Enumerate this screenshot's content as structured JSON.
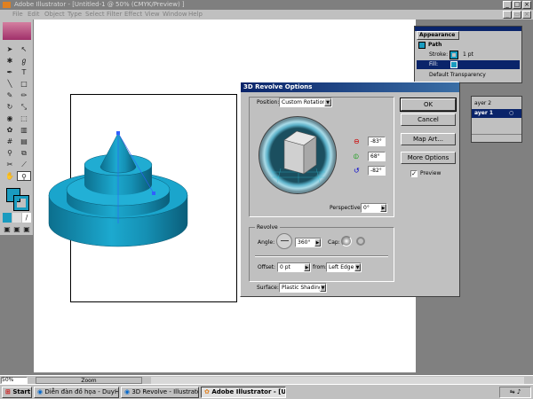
{
  "window": {
    "title": "Adobe Illustrator - [Untitled-1 @ 50% (CMYK/Preview) ]"
  },
  "menu": [
    "File",
    "Edit",
    "Object",
    "Type",
    "Select",
    "Filter",
    "Effect",
    "View",
    "Window",
    "Help"
  ],
  "appearance": {
    "tab": "Appearance",
    "path_label": "Path",
    "stroke_label": "Stroke:",
    "stroke_value": "1 pt",
    "fill_label": "Fill:",
    "transparency_label": "Default Transparency"
  },
  "layers": {
    "layer2": "ayer 2",
    "layer1": "ayer 1"
  },
  "dialog": {
    "title": "3D Revolve Options",
    "position_label": "Position:",
    "position_value": "Custom Rotation",
    "rot_x": "-83°",
    "rot_y": "68°",
    "rot_z": "-82°",
    "perspective_label": "Perspective:",
    "perspective_value": "0°",
    "revolve_group": "Revolve",
    "angle_label": "Angle:",
    "angle_value": "360°",
    "cap_label": "Cap:",
    "offset_label": "Offset:",
    "offset_value": "0 pt",
    "from_label": "from:",
    "from_value": "Left Edge",
    "surface_label": "Surface:",
    "surface_value": "Plastic Shading",
    "ok": "OK",
    "cancel": "Cancel",
    "map_art": "Map Art...",
    "more_options": "More Options",
    "preview_label": "Preview",
    "preview_checked": "✓"
  },
  "statusbar": {
    "zoom_value": "50%",
    "zoom_label": "Zoom"
  },
  "taskbar": {
    "start": "Start",
    "tasks": [
      "Diễn đàn đồ họa - DuyH...",
      "3D Revolve - Illustrate CS...",
      "Adobe Illustrator - [U..."
    ]
  },
  "colors": {
    "fill": "#1a9bbf",
    "accent": "#0a246a"
  }
}
